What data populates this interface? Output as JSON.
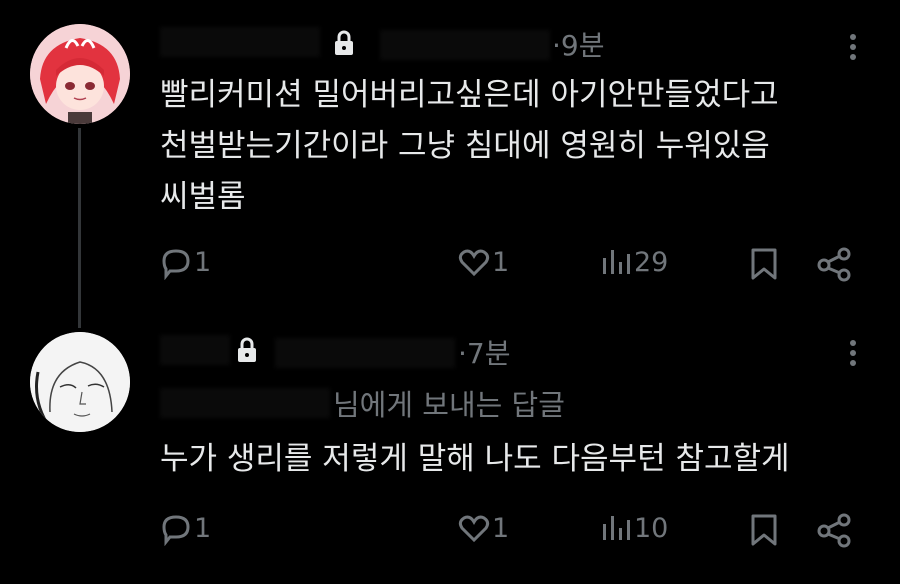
{
  "posts": [
    {
      "time": "·9분",
      "text": "빨리커미션 밀어버리고싶은데 아기안만들었다고\n천벌받는기간이라 그냥 침대에 영원히 누워있음\n씨벌롬",
      "reply_to": "",
      "reply_count": "1",
      "like_count": "1",
      "view_count": "29"
    },
    {
      "time": "·7분",
      "text": "누가 생리를 저렇게 말해 나도 다음부턴 참고할게",
      "reply_to": "님에게 보내는 답글",
      "reply_count": "1",
      "like_count": "1",
      "view_count": "10"
    }
  ],
  "icons": {
    "reply": "reply-icon",
    "like": "heart-icon",
    "views": "views-icon",
    "bookmark": "bookmark-icon",
    "share": "share-icon",
    "lock": "lock-icon",
    "more": "more-icon"
  },
  "colors": {
    "background": "#000000",
    "text": "#e7e9ea",
    "muted": "#71767b"
  }
}
